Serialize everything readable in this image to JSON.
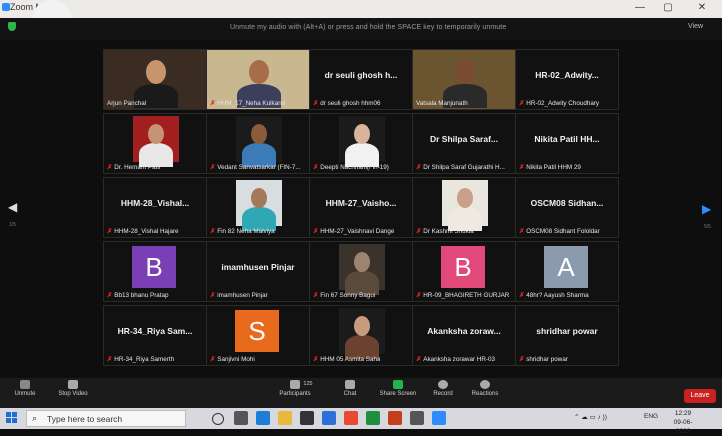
{
  "window": {
    "app_title": "Zoom M",
    "minimize": "—",
    "maximize": "▢",
    "close": "✕"
  },
  "banner": {
    "unmute_hint": "Unmute my audio with (Alt+A) or press and hold the SPACE key to temporarily unmute"
  },
  "view_button": "View",
  "pages": {
    "left": "1/5",
    "right": "5/5"
  },
  "participants": [
    {
      "label": "Arjun Panchal",
      "big_name": "",
      "type": "video",
      "muted": false
    },
    {
      "label": "HHM_17_Neha Kulkarni",
      "big_name": "",
      "type": "video",
      "muted": true
    },
    {
      "label": "dr seuli ghosh hhm06",
      "big_name": "dr seuli ghosh h...",
      "type": "name",
      "muted": true
    },
    {
      "label": "Vatsala Manjunath",
      "big_name": "",
      "type": "video",
      "muted": false
    },
    {
      "label": "HR-02_Adwity Choudhary",
      "big_name": "HR-02_Adwity...",
      "type": "name",
      "muted": true
    },
    {
      "label": "Dr. Hemant Patil",
      "big_name": "",
      "type": "photo",
      "muted": true
    },
    {
      "label": "Vedant Sanvatsarkar (FIN-7...",
      "big_name": "",
      "type": "photo",
      "muted": true
    },
    {
      "label": "Deepti Nachnani(Fin-19)",
      "big_name": "",
      "type": "photo",
      "muted": true
    },
    {
      "label": "Dr Shilpa Saraf Gujarathi H...",
      "big_name": "Dr Shilpa Saraf...",
      "type": "name",
      "muted": true
    },
    {
      "label": "Nikita Patil HHM 29",
      "big_name": "Nikita Patil HH...",
      "type": "name",
      "muted": true
    },
    {
      "label": "HHM-28_Vishal Hajare",
      "big_name": "HHM-28_Vishal...",
      "type": "name",
      "muted": true
    },
    {
      "label": "Fin 82 Neha Malviya",
      "big_name": "",
      "type": "photo",
      "muted": true
    },
    {
      "label": "HHM-27_Vaishnavi Dange",
      "big_name": "HHM-27_Vaisho...",
      "type": "name",
      "muted": true
    },
    {
      "label": "Dr Kashmi Shukla",
      "big_name": "",
      "type": "photo",
      "muted": true
    },
    {
      "label": "OSCM08 Sidhant Fololdar",
      "big_name": "OSCM08 Sidhan...",
      "type": "name",
      "muted": true
    },
    {
      "label": "Bb13 bhanu Pratap",
      "big_name": "",
      "type": "avatar",
      "letter": "B",
      "color": "#7b3fb5",
      "muted": true
    },
    {
      "label": "imamhusen Pinjar",
      "big_name": "imamhusen Pinjar",
      "type": "name",
      "muted": true
    },
    {
      "label": "Fin 67 Sonny Bagui",
      "big_name": "",
      "type": "photo",
      "muted": true
    },
    {
      "label": "HR-09_BHAGIRETH GURJAR",
      "big_name": "",
      "type": "avatar",
      "letter": "B",
      "color": "#e0497a",
      "muted": true
    },
    {
      "label": "48hr? Aayush Sharma",
      "big_name": "",
      "type": "avatar",
      "letter": "A",
      "color": "#8c9aae",
      "muted": true
    },
    {
      "label": "HR-34_Riya Samerth",
      "big_name": "HR-34_Riya Sam...",
      "type": "name",
      "muted": true
    },
    {
      "label": "Sanjivni Mohi",
      "big_name": "",
      "type": "avatar",
      "letter": "S",
      "color": "#e86a1c",
      "muted": true
    },
    {
      "label": "HHM 05 Asmita Saha",
      "big_name": "",
      "type": "photo",
      "muted": true
    },
    {
      "label": "Akanksha zorawar HR-03",
      "big_name": "Akanksha zoraw...",
      "type": "name",
      "muted": true
    },
    {
      "label": "shridhar powar",
      "big_name": "shridhar powar",
      "type": "name",
      "muted": true
    }
  ],
  "toolbar": {
    "unmute": "Unmute",
    "stop_video": "Stop Video",
    "participants": "Participants",
    "participants_count": "125",
    "chat": "Chat",
    "share_screen": "Share Screen",
    "record": "Record",
    "reactions": "Reactions",
    "leave": "Leave"
  },
  "taskbar": {
    "search_placeholder": "Type here to search",
    "language": "ENG",
    "time": "12:29",
    "date": "09-06-2022"
  },
  "colors": {
    "mute_red": "#e02828",
    "leave_red": "#c8211f",
    "share_green": "#1fb650",
    "zoom_blue": "#2d8cff"
  }
}
